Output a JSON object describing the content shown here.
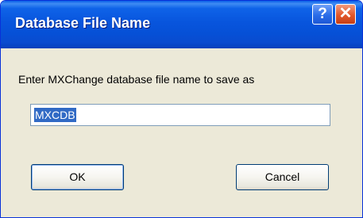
{
  "window": {
    "title": "Database File Name",
    "help_glyph": "?",
    "close_glyph": "✕"
  },
  "prompt": "Enter MXChange database file name to save as",
  "filename": {
    "value": "MXCDB",
    "selected": true
  },
  "buttons": {
    "ok_label": "OK",
    "cancel_label": "Cancel"
  },
  "colors": {
    "titlebar": "#0855dd",
    "dialog_background": "#ece9d8",
    "selection": "#316ac5",
    "close_button": "#e2572b"
  }
}
